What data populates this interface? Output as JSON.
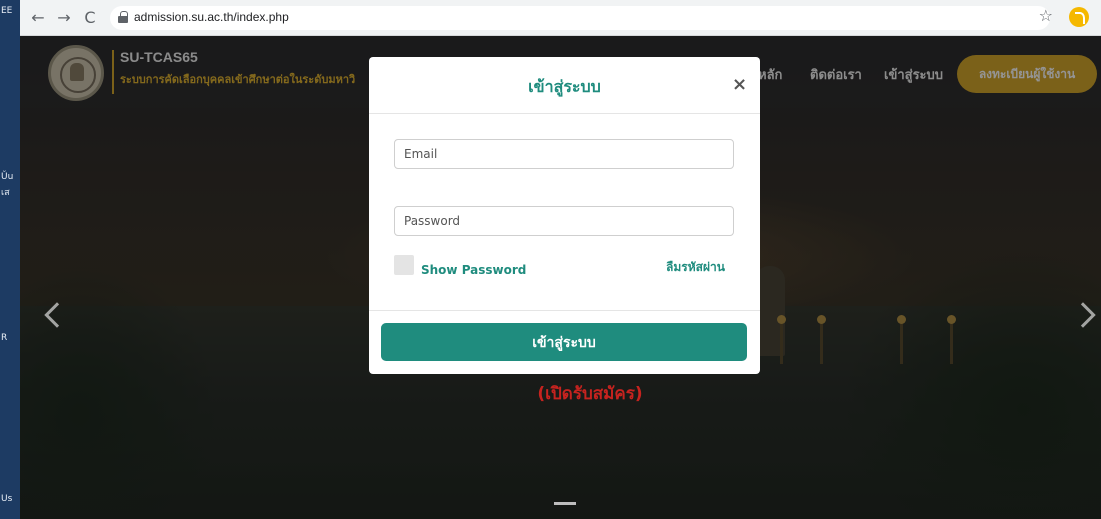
{
  "desktop": {
    "labels": [
      "EE",
      "Ŭu",
      "เส",
      "R",
      "Us"
    ]
  },
  "browser": {
    "url": "admission.su.ac.th/index.php",
    "back_icon": "←",
    "forward_icon": "→",
    "reload_icon": "C",
    "star_icon": "☆"
  },
  "site": {
    "title": "SU-TCAS65",
    "subtitle": "ระบบการคัดเลือกบุคคลเข้าศึกษาต่อในระดับมหาวิ",
    "nav": {
      "home": "หลัก",
      "contact": "ติดต่อเรา",
      "login": "เข้าสู่ระบบ",
      "register": "ลงทะเบียนผู้ใช้งาน"
    },
    "hero_text": "(เปิดรับสมัคร)",
    "colors": {
      "accent": "#1f8c7e",
      "gold": "#d4a72c",
      "hero_red": "#c6231f"
    }
  },
  "modal": {
    "title": "เข้าสู่ระบบ",
    "close_icon": "×",
    "email_placeholder": "Email",
    "password_placeholder": "Password",
    "show_password": "Show Password",
    "forgot_password": "ลืมรหัสผ่าน",
    "submit": "เข้าสู่ระบบ"
  }
}
